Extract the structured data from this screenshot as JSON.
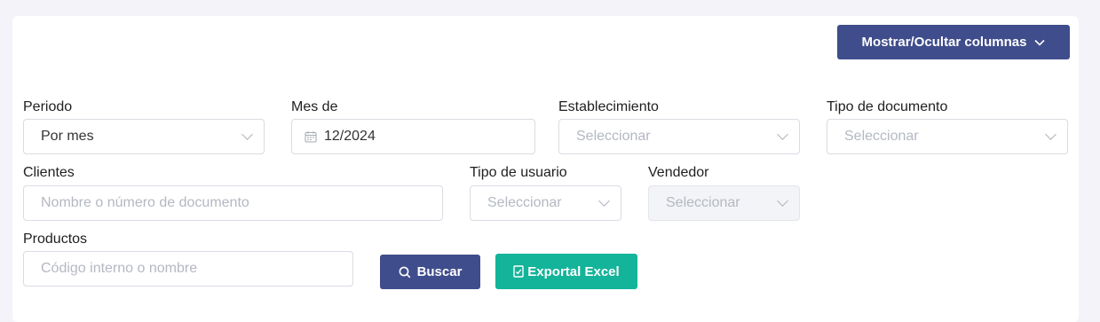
{
  "toolbar": {
    "columns_button": "Mostrar/Ocultar columnas"
  },
  "filters": {
    "periodo": {
      "label": "Periodo",
      "value": "Por mes"
    },
    "mes_de": {
      "label": "Mes de",
      "value": "12/2024"
    },
    "establecimiento": {
      "label": "Establecimiento",
      "placeholder": "Seleccionar"
    },
    "tipo_documento": {
      "label": "Tipo de documento",
      "placeholder": "Seleccionar"
    },
    "clientes": {
      "label": "Clientes",
      "placeholder": "Nombre o número de documento"
    },
    "tipo_usuario": {
      "label": "Tipo de usuario",
      "placeholder": "Seleccionar"
    },
    "vendedor": {
      "label": "Vendedor",
      "placeholder": "Seleccionar"
    },
    "productos": {
      "label": "Productos",
      "placeholder": "Código interno o nombre"
    }
  },
  "actions": {
    "search_label": "Buscar",
    "export_label": "Exportal Excel"
  },
  "colors": {
    "primary": "#3f4d8c",
    "success": "#13b49a",
    "background": "#f3f3f9"
  },
  "icons": {
    "columns_dropdown": "chevron-down-icon",
    "calendar": "calendar-icon",
    "search": "search-icon",
    "export": "file-export-icon"
  }
}
